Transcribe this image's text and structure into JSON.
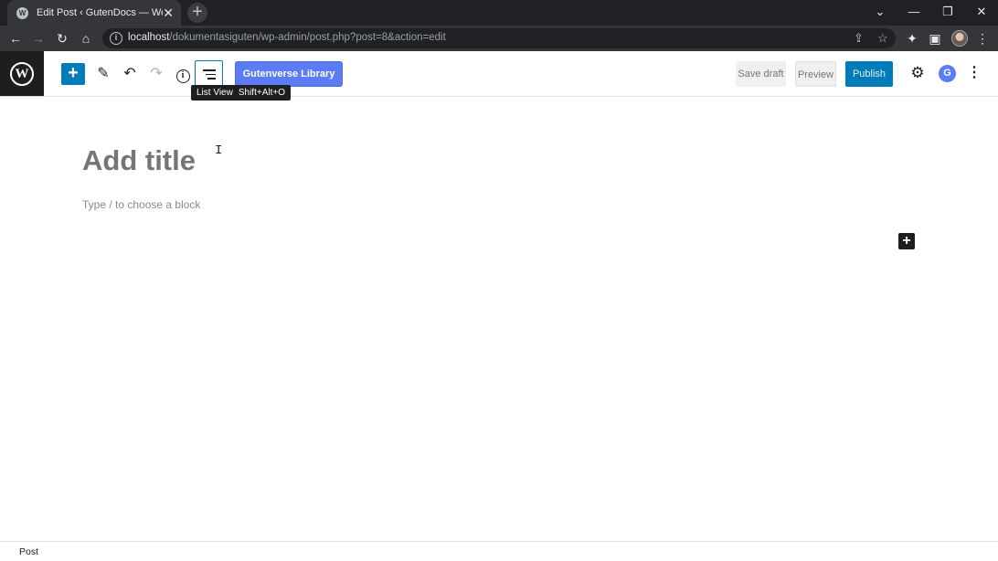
{
  "browser": {
    "tab_title": "Edit Post ‹ GutenDocs — WordPress",
    "tab_close": "✕",
    "new_tab": "+",
    "window_controls": {
      "dropdown": "⌄",
      "minimize": "—",
      "restore": "❐",
      "close": "✕"
    },
    "url_host": "localhost",
    "url_path": "/dokumentasiguten/wp-admin/post.php?post=8&action=edit",
    "nav_icons": {
      "back": "←",
      "forward": "→",
      "reload": "↻",
      "home": "⌂"
    },
    "omnibox_icons": {
      "share": "⇪",
      "bookmark": "☆"
    },
    "toolbar_icons": {
      "extensions": "✦",
      "sidebar": "▣",
      "menu": "⋮"
    }
  },
  "editor_header": {
    "inserter_icon": "+",
    "tools_icon": "✎",
    "undo_icon": "↶",
    "redo_icon": "↷",
    "details_icon": "i",
    "gutenverse_label": "Gutenverse Library",
    "tooltip_label": "List View",
    "tooltip_shortcut": "Shift+Alt+O",
    "save_draft_label": "Save draft",
    "preview_label": "Preview",
    "publish_label": "Publish",
    "settings_icon": "⚙",
    "gutenverse_icon": "G",
    "options_icon": "⋮"
  },
  "canvas": {
    "title_placeholder": "Add title",
    "block_placeholder": "Type / to choose a block",
    "block_inserter_icon": "+",
    "text_cursor": "I"
  },
  "footer": {
    "breadcrumb": "Post"
  },
  "colors": {
    "accent": "#007cba",
    "gutenverse": "#5b7cf5",
    "dark": "#1e1e1e"
  }
}
